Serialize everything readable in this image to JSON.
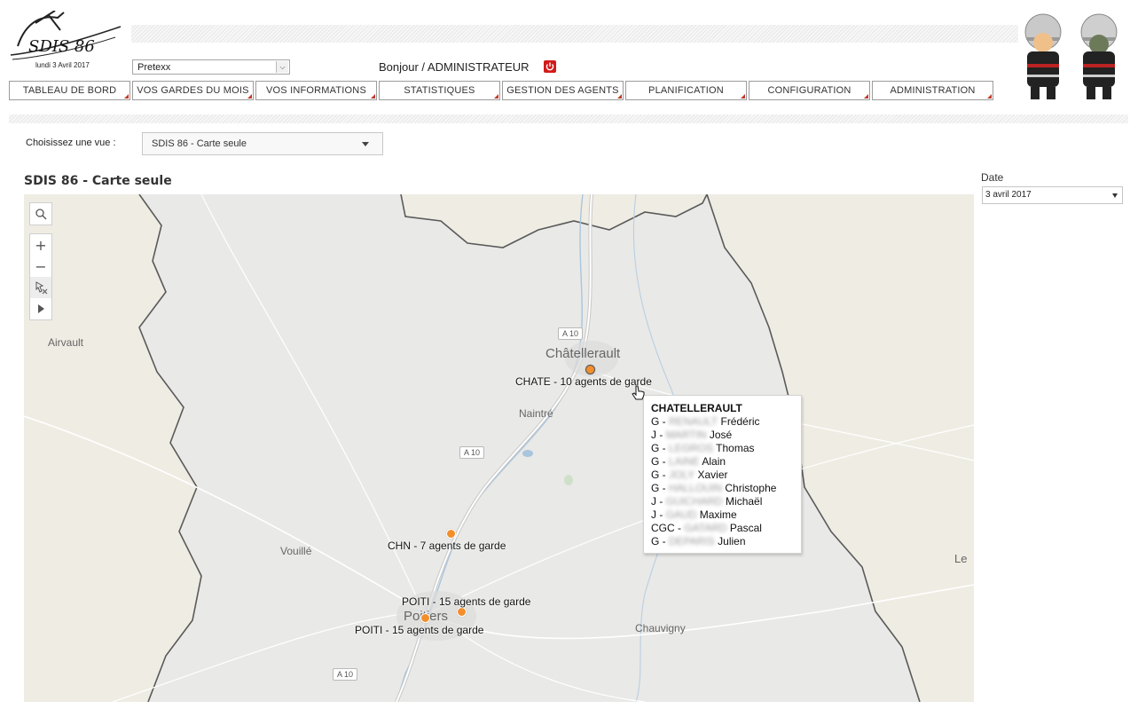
{
  "header": {
    "logo_text": "SDIS 86",
    "logo_date": "lundi 3 Avril 2017",
    "profile_select": "Pretexx",
    "greeting": "Bonjour / ADMINISTRATEUR"
  },
  "nav": [
    {
      "label": "TABLEAU DE BORD"
    },
    {
      "label": "VOS GARDES DU MOIS"
    },
    {
      "label": "VOS INFORMATIONS"
    },
    {
      "label": "STATISTIQUES"
    },
    {
      "label": "GESTION DES AGENTS"
    },
    {
      "label": "PLANIFICATION"
    },
    {
      "label": "CONFIGURATION"
    },
    {
      "label": "ADMINISTRATION"
    }
  ],
  "view": {
    "label": "Choisissez une vue :",
    "selected": "SDIS 86 - Carte seule"
  },
  "page_title": "SDIS 86 - Carte seule",
  "date_filter": {
    "label": "Date",
    "selected": "3 avril 2017"
  },
  "map": {
    "toolbar_icons": [
      "search-icon",
      "zoom-in-icon",
      "zoom-out-icon",
      "clear-selection-icon",
      "play-icon"
    ],
    "places": {
      "airvault": "Airvault",
      "chatellerault": "Châtellerault",
      "naintre": "Naintré",
      "vouille": "Vouillé",
      "poitiers": "Poitiers",
      "chauvigny": "Chauvigny",
      "le": "Le"
    },
    "roads": [
      "A 10",
      "A 10",
      "A 10"
    ],
    "markers": {
      "chate": "CHATE - 10 agents de garde",
      "chn": "CHN - 7 agents de garde",
      "poiti_1": "POITI - 15 agents de garde",
      "poiti_2": "POITI - 15 agents de garde"
    },
    "marker_color": "#f28e2b"
  },
  "tooltip": {
    "title": "CHATELLERAULT",
    "rows": [
      {
        "grade": "G -",
        "name": "RENAULT",
        "first": "Frédéric"
      },
      {
        "grade": "J -",
        "name": "MARTIN",
        "first": "José"
      },
      {
        "grade": "G -",
        "name": "LEGROS",
        "first": "Thomas"
      },
      {
        "grade": "G -",
        "name": "LAINE",
        "first": "Alain"
      },
      {
        "grade": "G -",
        "name": "JOLY",
        "first": "Xavier"
      },
      {
        "grade": "G -",
        "name": "HALLOUIN",
        "first": "Christophe"
      },
      {
        "grade": "J -",
        "name": "GUICHARD",
        "first": "Michaël"
      },
      {
        "grade": "J -",
        "name": "GAUD",
        "first": "Maxime"
      },
      {
        "grade": "CGC -",
        "name": "GATARD",
        "first": "Pascal"
      },
      {
        "grade": "G -",
        "name": "DEPARIS",
        "first": "Julien"
      }
    ]
  }
}
